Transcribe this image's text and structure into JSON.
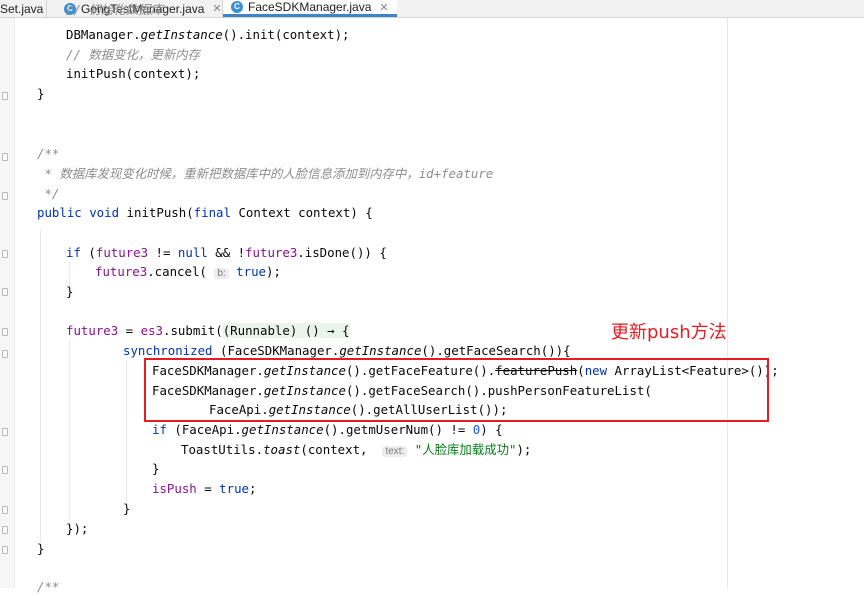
{
  "tabs": [
    {
      "label": "Set.java",
      "icon": "none",
      "active": false
    },
    {
      "label": "GongTestManager.java",
      "icon": "class-icon",
      "active": false
    },
    {
      "label": "FaceSDKManager.java",
      "icon": "class-icon",
      "active": true
    }
  ],
  "code": {
    "l0": "// 初始化数据库",
    "l1a": "DBManager.",
    "l1b": "getInstance",
    "l1c": "().init(context);",
    "l2": "// 数据变化，更新内存",
    "l3": "initPush(context);",
    "l4": "}",
    "l5": "/**",
    "l6": " * 数据库发现变化时候，重新把数据库中的人脸信息添加到内存中，id+feature",
    "l7": " */",
    "l8a": "public void ",
    "l8b": "initPush(",
    "l8c": "final ",
    "l8d": "Context context) {",
    "l9a": "if ",
    "l9b": "(",
    "l9c": "future3",
    "l9d": " != ",
    "l9e": "null ",
    "l9f": "&& !",
    "l9g": "future3",
    "l9h": ".isDone()) {",
    "l10a": "future3",
    "l10b": ".cancel( ",
    "l10hint": "b:",
    "l10c": " true",
    "l10d": ");",
    "l11": "}",
    "l12a": "future3",
    "l12b": " = ",
    "l12c": "es3",
    "l12d": ".submit(",
    "l12e": "(Runnable) () → {",
    "l13a": "synchronized ",
    "l13b": "(FaceSDKManager.",
    "l13c": "getInstance",
    "l13d": "().getFaceSearch()){",
    "l14a": "FaceSDKManager.",
    "l14b": "getInstance",
    "l14c": "().getFaceFeature().",
    "l14d": "featurePush",
    "l14e": "(",
    "l14f": "new ",
    "l14g": "ArrayList<Feature>());",
    "l15a": "FaceSDKManager.",
    "l15b": "getInstance",
    "l15c": "().getFaceSearch().pushPersonFeatureList(",
    "l16a": "FaceApi.",
    "l16b": "getInstance",
    "l16c": "().getAllUserList());",
    "l17a": "if ",
    "l17b": "(FaceApi.",
    "l17c": "getInstance",
    "l17d": "().getmUserNum() != ",
    "l17e": "0",
    "l17f": ") {",
    "l18a": "ToastUtils.",
    "l18b": "toast",
    "l18c": "(context,  ",
    "l18hint": "text:",
    "l18d": " \"人脸库加载成功\"",
    "l18e": ");",
    "l19": "}",
    "l20a": "isPush",
    "l20b": " = ",
    "l20c": "true",
    "l20d": ";",
    "l21": "}",
    "l22": "});",
    "l23": "}",
    "l24": "/**"
  },
  "annotation": {
    "label": "更新push方法",
    "color": "#e51c23"
  },
  "colors": {
    "keyword": "#0033b3",
    "field": "#871094",
    "comment": "#8c8c8c",
    "string": "#067d17",
    "number": "#1750eb",
    "accent": "#4083c9"
  }
}
